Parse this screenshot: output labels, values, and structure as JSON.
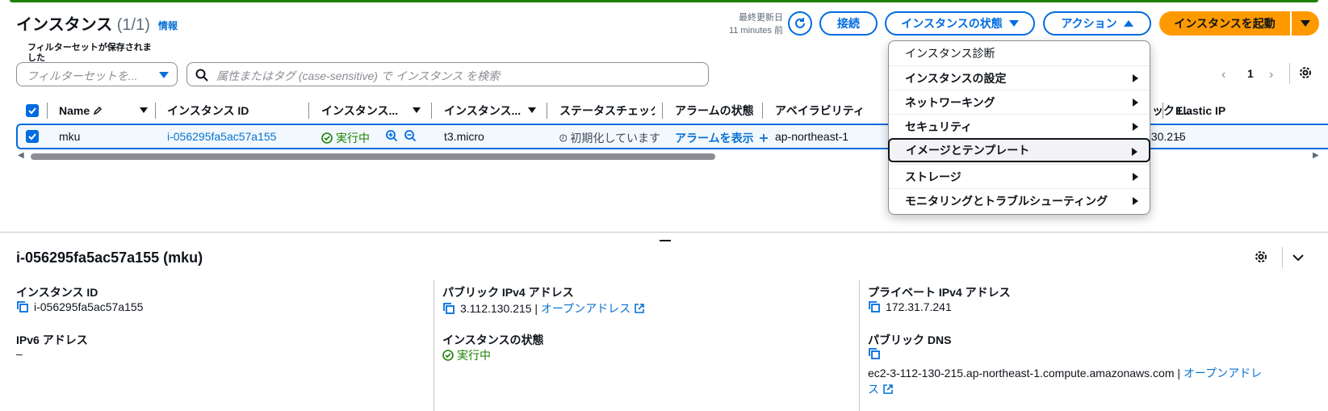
{
  "header": {
    "title": "インスタンス",
    "count": "(1/1)",
    "info": "情報",
    "last_updated_label": "最終更新日",
    "last_updated_value": "11 minutes 前",
    "connect": "接続",
    "instance_state": "インスタンスの状態",
    "actions": "アクション",
    "launch": "インスタンスを起動"
  },
  "filters": {
    "saved_label": "フィルターセットが保存されました",
    "saved_placeholder": "フィルターセットを...",
    "search_placeholder": "属性またはタグ (case-sensitive) で インスタンス を検索"
  },
  "pagination": {
    "page": "1"
  },
  "table": {
    "columns": [
      "Name",
      "インスタンス ID",
      "インスタンス...",
      "インスタンス...",
      "ステータスチェック",
      "アラームの状態",
      "アベイラビリティ",
      "ック I...",
      "Elastic IP"
    ],
    "row": {
      "name": "mku",
      "instance_id": "i-056295fa5ac57a155",
      "state": "実行中",
      "type": "t3.micro",
      "status_check": "初期化しています",
      "alarm": "アラームを表示",
      "az": "ap-northeast-1",
      "public_ip": "130.215",
      "elastic_ip": "–"
    }
  },
  "details": {
    "title": "i-056295fa5ac57a155 (mku)",
    "instance_id_label": "インスタンス ID",
    "instance_id": "i-056295fa5ac57a155",
    "ipv6_label": "IPv6 アドレス",
    "ipv6": "–",
    "public_ipv4_label": "パブリック IPv4 アドレス",
    "public_ipv4": "3.112.130.215",
    "open_address": "オープンアドレス",
    "state_label": "インスタンスの状態",
    "state": "実行中",
    "private_ipv4_label": "プライベート IPv4 アドレス",
    "private_ipv4": "172.31.7.241",
    "public_dns_label": "パブリック DNS",
    "public_dns": "ec2-3-112-130-215.ap-northeast-1.compute.amazonaws.com",
    "open_address_2a": "オープンアドレ",
    "open_address_2b": "ス"
  },
  "actions_menu": {
    "items": [
      "インスタンス診断",
      "インスタンスの設定",
      "ネットワーキング",
      "セキュリティ",
      "イメージとテンプレート",
      "ストレージ",
      "モニタリングとトラブルシューティング"
    ]
  },
  "colors": {
    "accent": "#006ce0",
    "launch": "#ff9900",
    "success": "#1d8102"
  }
}
